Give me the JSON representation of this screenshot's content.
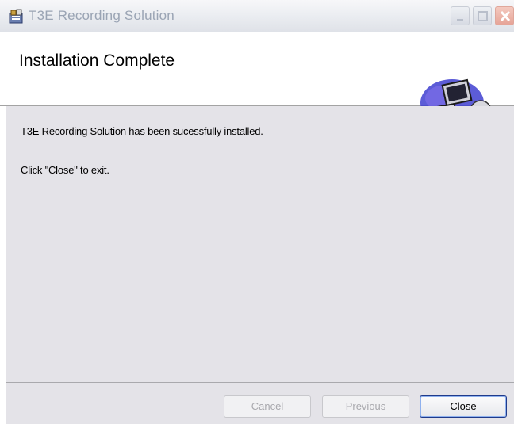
{
  "window": {
    "title": "T3E Recording Solution",
    "controls": [
      "minimize",
      "maximize",
      "close"
    ]
  },
  "banner": {
    "title": "Installation Complete",
    "art_icon": "computer-with-disc-icon"
  },
  "content": {
    "message": "T3E Recording Solution has been sucessfully installed.",
    "instruction": "Click \"Close\" to exit."
  },
  "footer": {
    "cancel_label": "Cancel",
    "previous_label": "Previous",
    "close_label": "Close"
  },
  "colors": {
    "dialog_background": "#e4e3e8",
    "banner_background": "#ffffff",
    "title_text": "#9aa4b4",
    "default_button_border": "#1f3a8a"
  }
}
